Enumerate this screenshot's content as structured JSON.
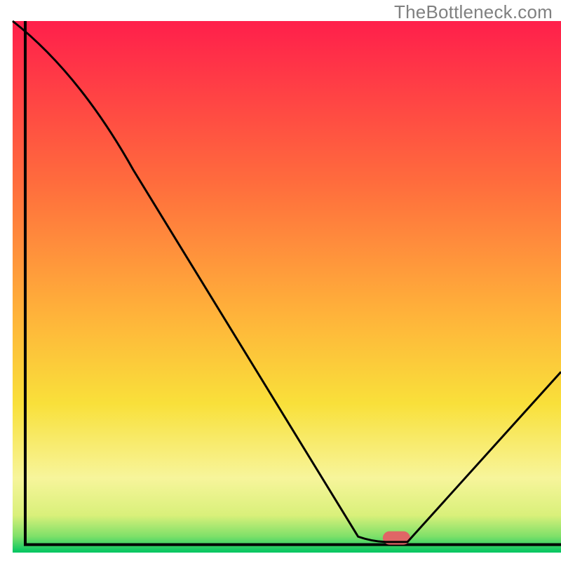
{
  "watermark": "TheBottleneck.com",
  "chart_data": {
    "type": "line",
    "title": "",
    "xlabel": "",
    "ylabel": "",
    "xlim": [
      0,
      100
    ],
    "ylim": [
      0,
      100
    ],
    "gradient_stops": [
      {
        "offset": 0,
        "color": "#ff1f4b"
      },
      {
        "offset": 30,
        "color": "#ff6b3d"
      },
      {
        "offset": 55,
        "color": "#ffb23a"
      },
      {
        "offset": 72,
        "color": "#f9e03a"
      },
      {
        "offset": 86,
        "color": "#f7f59b"
      },
      {
        "offset": 93,
        "color": "#d9f07a"
      },
      {
        "offset": 97,
        "color": "#7de069"
      },
      {
        "offset": 100,
        "color": "#00c561"
      }
    ],
    "series": [
      {
        "name": "bottleneck-curve",
        "color": "#000000",
        "x": [
          0,
          22,
          63,
          68,
          72,
          100
        ],
        "values": [
          100,
          72,
          3,
          2,
          2,
          34
        ]
      }
    ],
    "marker": {
      "name": "highlight-marker",
      "color": "#e06666",
      "x_center": 70,
      "width": 5,
      "y": 1.5,
      "height": 2.5
    },
    "frame": {
      "left_x": 2.3,
      "right_x": 100,
      "top_y": 100,
      "bottom_y": 1.5
    }
  }
}
